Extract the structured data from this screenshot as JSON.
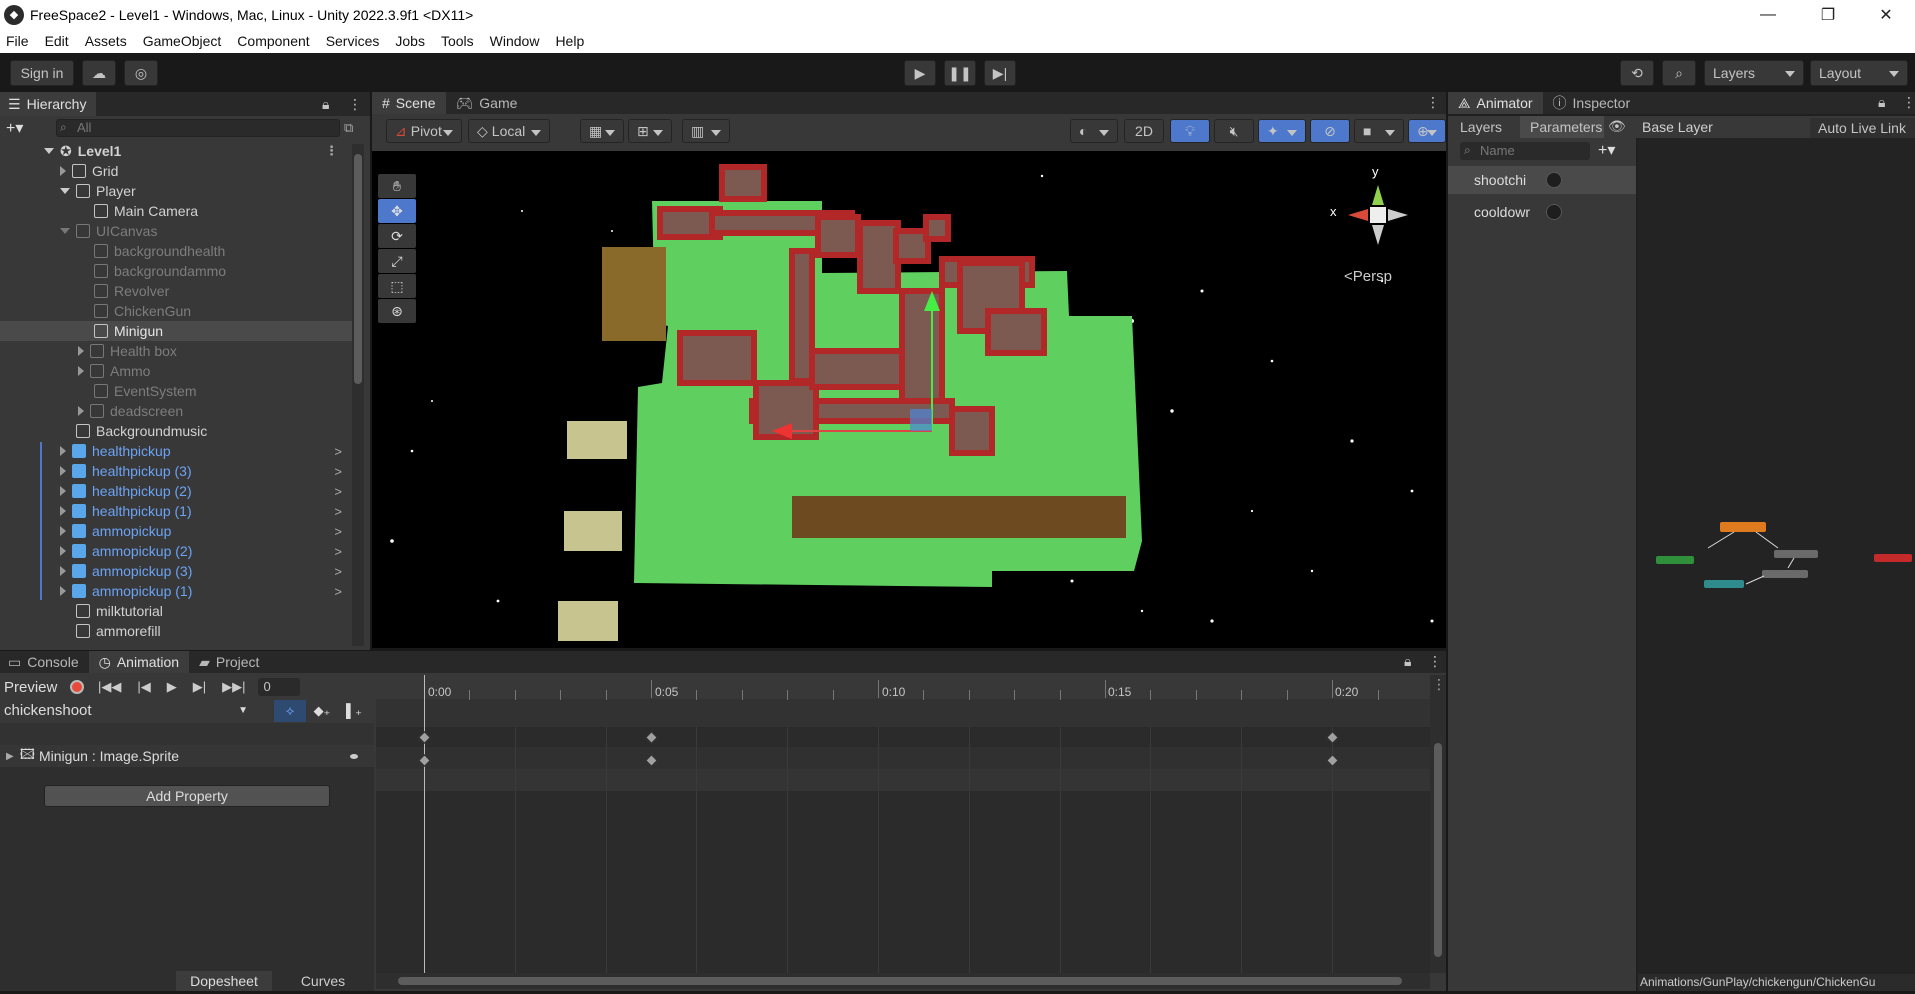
{
  "window": {
    "title": "FreeSpace2 - Level1 - Windows, Mac, Linux - Unity 2022.3.9f1 <DX11>"
  },
  "menu": [
    "File",
    "Edit",
    "Assets",
    "GameObject",
    "Component",
    "Services",
    "Jobs",
    "Tools",
    "Window",
    "Help"
  ],
  "toolbar": {
    "sign_in": "Sign in",
    "layers": "Layers",
    "layout": "Layout"
  },
  "hierarchy": {
    "tab": "Hierarchy",
    "search_placeholder": "All",
    "rows": [
      {
        "label": "Level1"
      },
      {
        "label": "Grid"
      },
      {
        "label": "Player"
      },
      {
        "label": "Main Camera"
      },
      {
        "label": "UICanvas"
      },
      {
        "label": "backgroundhealth"
      },
      {
        "label": "backgroundammo"
      },
      {
        "label": "Revolver"
      },
      {
        "label": "ChickenGun"
      },
      {
        "label": "Minigun"
      },
      {
        "label": "Health box"
      },
      {
        "label": "Ammo"
      },
      {
        "label": "EventSystem"
      },
      {
        "label": "deadscreen"
      },
      {
        "label": "Backgroundmusic"
      },
      {
        "label": "healthpickup"
      },
      {
        "label": "healthpickup (3)"
      },
      {
        "label": "healthpickup (2)"
      },
      {
        "label": "healthpickup (1)"
      },
      {
        "label": "ammopickup"
      },
      {
        "label": "ammopickup (2)"
      },
      {
        "label": "ammopickup (3)"
      },
      {
        "label": "ammopickup (1)"
      },
      {
        "label": "milktutorial"
      },
      {
        "label": "ammorefill"
      }
    ]
  },
  "scene": {
    "tabs": [
      "Scene",
      "Game"
    ],
    "pivot": "Pivot",
    "local": "Local",
    "twod": "2D",
    "persp": "Persp",
    "axis_x": "x",
    "axis_y": "y"
  },
  "animator": {
    "tabs": [
      "Animator",
      "Inspector"
    ],
    "sub_tabs": [
      "Layers",
      "Parameters"
    ],
    "base_layer": "Base Layer",
    "auto_live": "Auto Live Link",
    "search_placeholder": "Name",
    "params": [
      "shootchi",
      "cooldowr"
    ],
    "path": "Animations/GunPlay/chickengun/ChickenGu"
  },
  "bottom": {
    "tabs": [
      "Console",
      "Animation",
      "Project"
    ],
    "preview": "Preview",
    "frame": "0",
    "clip": "chickenshoot",
    "property": "Minigun : Image.Sprite",
    "add_property": "Add Property",
    "dopesheet": "Dopesheet",
    "curves": "Curves",
    "time_labels": [
      "0:00",
      "0:05",
      "0:10",
      "0:15",
      "0:20"
    ]
  },
  "colors": {
    "accent": "#4d78cc",
    "record": "#e84b3c",
    "grass": "#5fcf5f",
    "wall": "#b22828",
    "floor": "#7c5a52"
  }
}
